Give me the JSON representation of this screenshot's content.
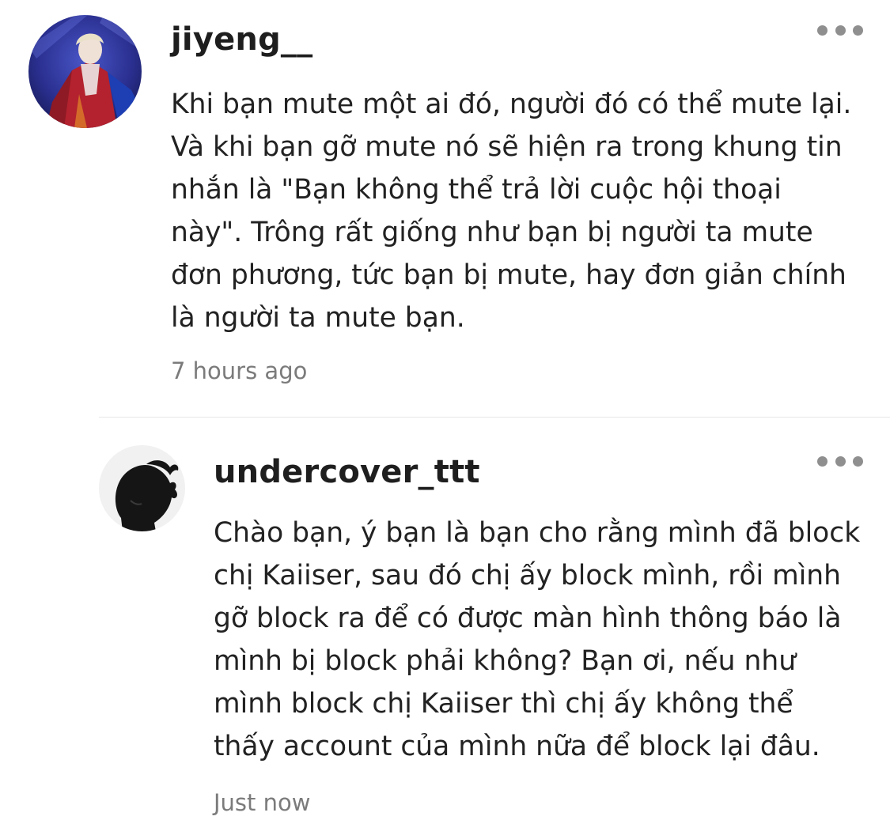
{
  "comments": [
    {
      "username": "jiyeng__",
      "body_lines": [
        "Khi bạn mute một ai đó, người đó có thể mute lại.",
        "Và khi bạn gỡ mute nó sẽ hiện ra trong khung tin",
        "nhắn là \"Bạn không thể trả lời cuộc hội thoại",
        "này\". Trông rất giống như bạn bị người ta mute",
        "đơn phương, tức bạn bị mute, hay đơn giản chính",
        "là người ta mute bạn."
      ],
      "timestamp": "7 hours ago",
      "more_icon": "more-horizontal-icon"
    },
    {
      "username": "undercover_ttt",
      "body_lines": [
        "Chào bạn, ý bạn là bạn cho rằng mình đã block",
        "chị Kaiiser, sau đó chị ấy block mình, rồi mình",
        "gỡ block ra để có được màn hình thông báo là",
        "mình bị block phải không? Bạn ơi, nếu như",
        "mình block chị Kaiiser thì chị ấy không thể",
        "thấy account của mình nữa để block lại đâu."
      ],
      "timestamp": "Just now",
      "more_icon": "more-horizontal-icon"
    }
  ],
  "colors": {
    "username": "#1e1e1e",
    "body": "#222222",
    "timestamp": "#7b7b7b",
    "dots": "#8f8f8f",
    "divider": "#e6e6e6"
  }
}
